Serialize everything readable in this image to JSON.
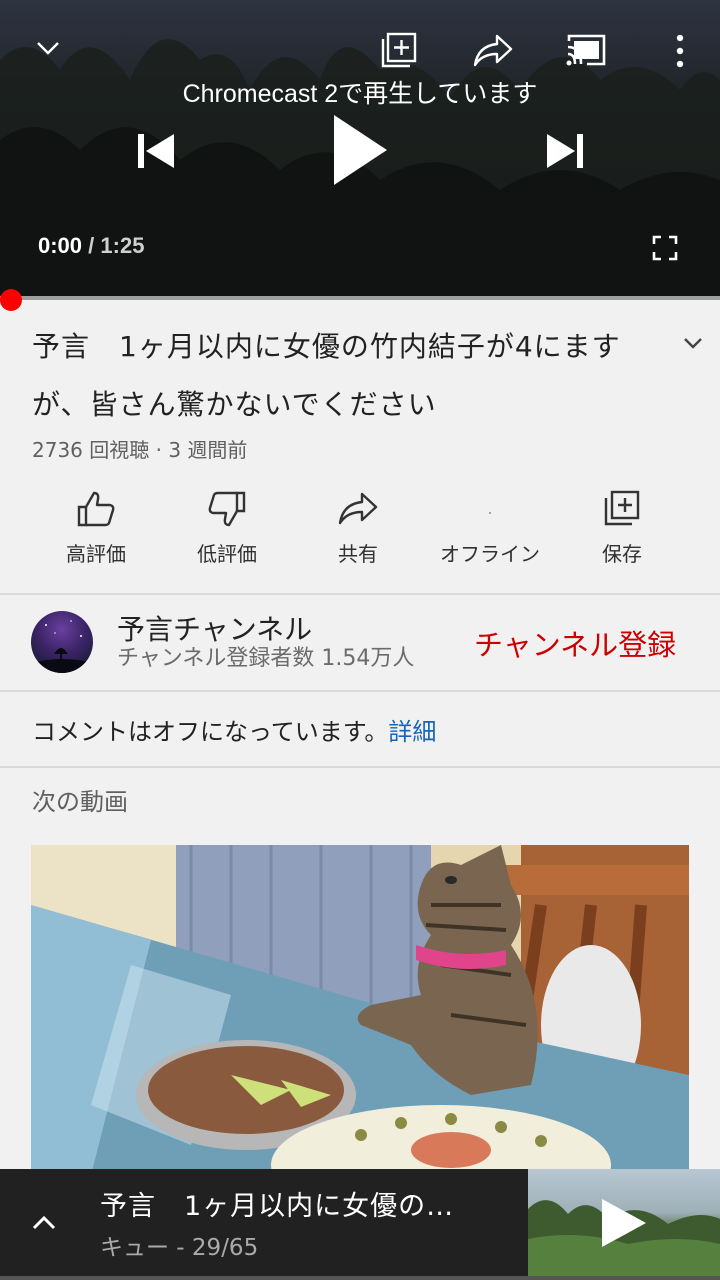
{
  "player": {
    "cast_status": "Chromecast 2で再生しています",
    "time_current": "0:00",
    "time_separator": " / ",
    "time_duration": "1:25",
    "progress_fraction": 0.0,
    "icons": [
      "chevron-down-icon",
      "add-to-playlist-icon",
      "share-icon",
      "cast-icon",
      "more-vert-icon",
      "previous-icon",
      "play-icon",
      "next-icon",
      "fullscreen-icon"
    ]
  },
  "video": {
    "title": "予言　1ヶ月以内に女優の竹内結子が4にますが、皆さん驚かないでください",
    "meta": "2736 回視聴 · 3 週間前"
  },
  "actions": {
    "like": "高評価",
    "dislike": "低評価",
    "share": "共有",
    "offline": "オフライン",
    "save": "保存"
  },
  "channel": {
    "name": "予言チャンネル",
    "subscribers": "チャンネル登録者数 1.54万人",
    "subscribe_label": "チャンネル登録"
  },
  "comments": {
    "text": "コメントはオフになっています。",
    "link": "詳細"
  },
  "up_next": {
    "label": "次の動画"
  },
  "mini_player": {
    "title": "予言　1ヶ月以内に女優の…",
    "queue": "キュー - 29/65"
  },
  "colors": {
    "accent_red": "#ff0000",
    "subscribe_red": "#cc0000",
    "link_blue": "#1565c0",
    "mini_bg": "#212121"
  }
}
